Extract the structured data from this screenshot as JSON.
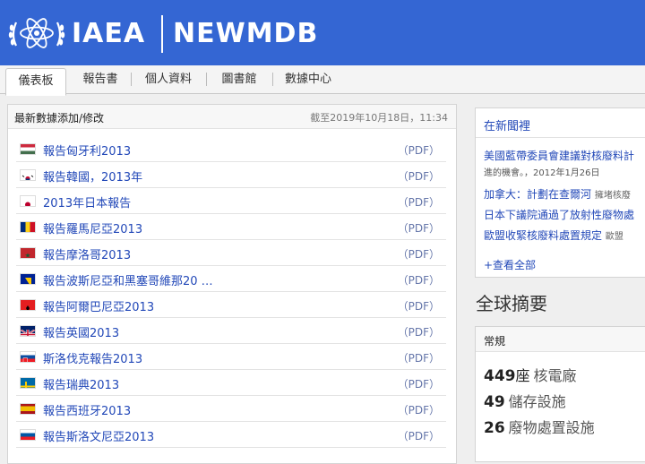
{
  "header": {
    "brand_left": "IAEA",
    "brand_right": "NEWMDB",
    "accent_color": "#3466d3"
  },
  "tabs": [
    {
      "label": "儀表板",
      "active": true
    },
    {
      "label": "報告書",
      "active": false
    },
    {
      "label": "個人資料",
      "active": false
    },
    {
      "label": "圖書館",
      "active": false
    },
    {
      "label": "數據中心",
      "active": false
    }
  ],
  "latest": {
    "title": "最新數據添加/修改",
    "date": "截至2019年10月18日，11:34",
    "pdf_label": "（PDF）",
    "reports": [
      {
        "label": "報告匈牙利2013",
        "flag": "hungary"
      },
      {
        "label": "報告韓國，2013年",
        "flag": "korea"
      },
      {
        "label": "2013年日本報告",
        "flag": "japan"
      },
      {
        "label": "報告羅馬尼亞2013",
        "flag": "romania"
      },
      {
        "label": "報告摩洛哥2013",
        "flag": "morocco"
      },
      {
        "label": "報告波斯尼亞和黑塞哥維那20 …",
        "flag": "bosnia"
      },
      {
        "label": "報告阿爾巴尼亞2013",
        "flag": "albania"
      },
      {
        "label": "報告英國2013",
        "flag": "uk"
      },
      {
        "label": "斯洛伐克報告2013",
        "flag": "slovakia"
      },
      {
        "label": "報告瑞典2013",
        "flag": "sweden"
      },
      {
        "label": "報告西班牙2013",
        "flag": "spain"
      },
      {
        "label": "報告斯洛文尼亞2013",
        "flag": "slovenia"
      }
    ]
  },
  "news": {
    "title": "在新聞裡",
    "items": [
      {
        "title": "美國藍帶委員會建議對核廢料計",
        "sub": "進的機會。，2012年1月26日"
      },
      {
        "title": "加拿大：計劃在查爾河",
        "tail": "擁堵核廢"
      },
      {
        "title": "日本下議院通過了放射性廢物處",
        "tail": ""
      },
      {
        "title": "歐盟收緊核廢料處置規定",
        "tail": "歐盟"
      }
    ],
    "more": "+查看全部"
  },
  "global": {
    "title": "全球摘要",
    "section": "常規",
    "stats": [
      {
        "value": "449",
        "unit": "座",
        "label": "核電廠"
      },
      {
        "value": "49",
        "unit": "",
        "label": "儲存設施"
      },
      {
        "value": "26",
        "unit": "",
        "label": "廢物處置設施"
      }
    ]
  }
}
